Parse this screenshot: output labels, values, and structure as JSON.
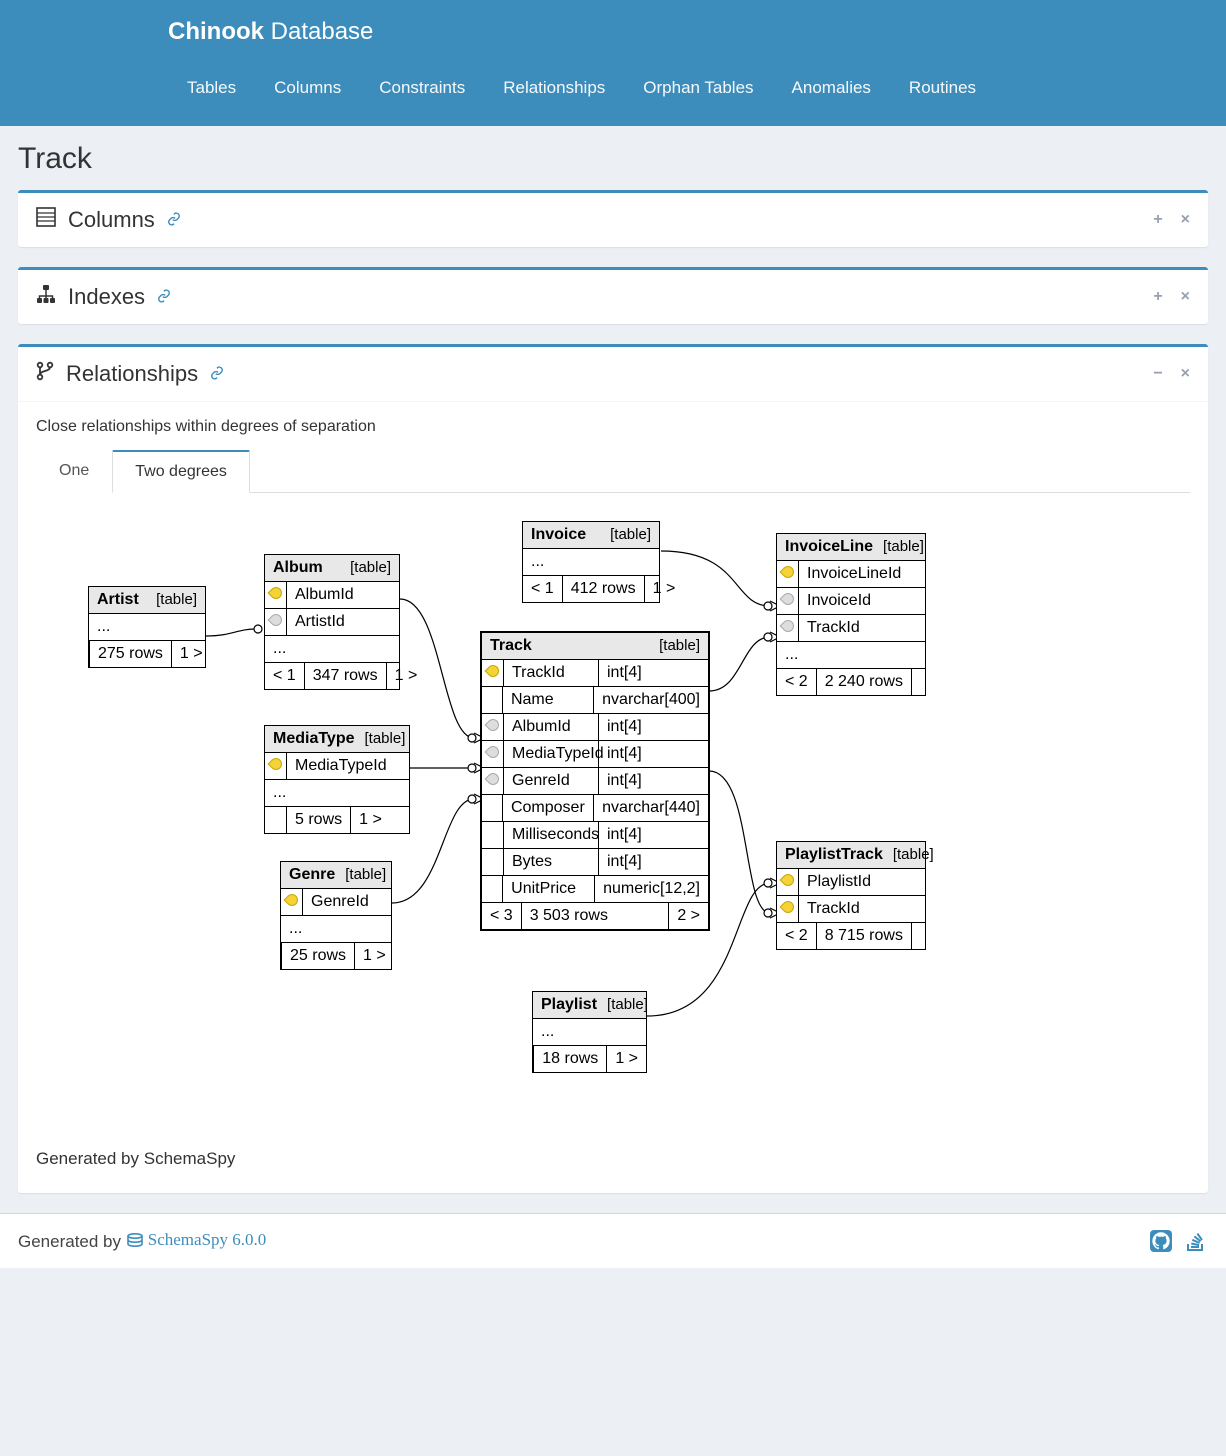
{
  "header": {
    "brand_strong": "Chinook",
    "brand_rest": " Database",
    "nav": [
      "Tables",
      "Columns",
      "Constraints",
      "Relationships",
      "Orphan Tables",
      "Anomalies",
      "Routines"
    ]
  },
  "page_title": "Track",
  "panels": {
    "columns": {
      "title": "Columns"
    },
    "indexes": {
      "title": "Indexes"
    },
    "relationships": {
      "title": "Relationships",
      "description": "Close relationships within degrees of separation",
      "tabs": [
        "One",
        "Two degrees"
      ],
      "active_tab": "Two degrees"
    }
  },
  "erd": {
    "generated_by": "Generated by SchemaSpy",
    "entities": {
      "artist": {
        "name": "Artist",
        "type": "[table]",
        "rows": "275 rows",
        "out": "1 >"
      },
      "album": {
        "name": "Album",
        "type": "[table]",
        "cols": [
          [
            "pk",
            "AlbumId"
          ],
          [
            "fk",
            "ArtistId"
          ]
        ],
        "rows": "347 rows",
        "in": "< 1",
        "out": "1 >"
      },
      "mediatype": {
        "name": "MediaType",
        "type": "[table]",
        "cols": [
          [
            "pk",
            "MediaTypeId"
          ]
        ],
        "rows": "5 rows",
        "out": "1 >"
      },
      "genre": {
        "name": "Genre",
        "type": "[table]",
        "cols": [
          [
            "pk",
            "GenreId"
          ]
        ],
        "rows": "25 rows",
        "out": "1 >"
      },
      "invoice": {
        "name": "Invoice",
        "type": "[table]",
        "rows": "412 rows",
        "in": "< 1",
        "out": "1 >"
      },
      "playlist": {
        "name": "Playlist",
        "type": "[table]",
        "rows": "18 rows",
        "out": "1 >"
      },
      "invoiceline": {
        "name": "InvoiceLine",
        "type": "[table]",
        "cols": [
          [
            "pk",
            "InvoiceLineId"
          ],
          [
            "fk",
            "InvoiceId"
          ],
          [
            "fk",
            "TrackId"
          ]
        ],
        "rows": "2 240 rows",
        "in": "< 2"
      },
      "playlisttrack": {
        "name": "PlaylistTrack",
        "type": "[table]",
        "cols": [
          [
            "pk",
            "PlaylistId"
          ],
          [
            "pk",
            "TrackId"
          ]
        ],
        "rows": "8 715 rows",
        "in": "< 2"
      },
      "track": {
        "name": "Track",
        "type": "[table]",
        "columns": [
          [
            "pk",
            "TrackId",
            "int[4]"
          ],
          [
            "",
            "Name",
            "nvarchar[400]"
          ],
          [
            "fk",
            "AlbumId",
            "int[4]"
          ],
          [
            "fk",
            "MediaTypeId",
            "int[4]"
          ],
          [
            "fk",
            "GenreId",
            "int[4]"
          ],
          [
            "",
            "Composer",
            "nvarchar[440]"
          ],
          [
            "",
            "Milliseconds",
            "int[4]"
          ],
          [
            "",
            "Bytes",
            "int[4]"
          ],
          [
            "",
            "UnitPrice",
            "numeric[12,2]"
          ]
        ],
        "rows": "3 503 rows",
        "in": "< 3",
        "out": "2 >"
      }
    }
  },
  "footer": {
    "generated_by": "Generated by",
    "tool": "SchemaSpy 6.0.0"
  }
}
